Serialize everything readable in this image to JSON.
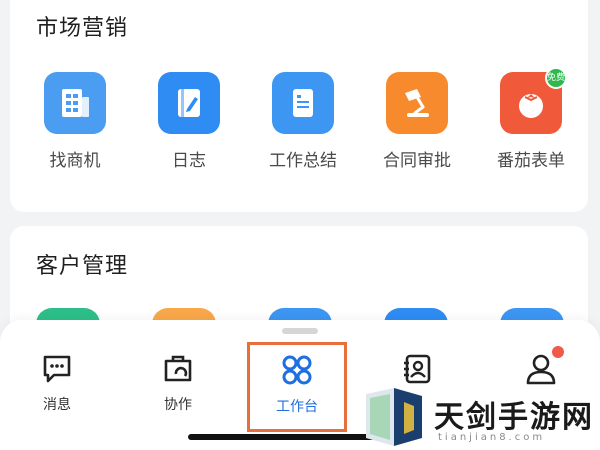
{
  "marketing": {
    "title": "市场营销",
    "apps": [
      {
        "label": "找商机",
        "color": "#4a9df0",
        "icon": "building-icon"
      },
      {
        "label": "日志",
        "color": "#2f8cf2",
        "icon": "journal-icon"
      },
      {
        "label": "工作总结",
        "color": "#3d96f2",
        "icon": "document-icon"
      },
      {
        "label": "合同审批",
        "color": "#f88a2e",
        "icon": "desk-lamp-icon"
      },
      {
        "label": "番茄表单",
        "color": "#f05a3a",
        "icon": "tomato-icon",
        "badge": "免费"
      }
    ]
  },
  "customer": {
    "title": "客户管理"
  },
  "tabs": [
    {
      "label": "消息",
      "icon": "chat-icon",
      "active": false
    },
    {
      "label": "协作",
      "icon": "briefcase-icon",
      "active": false
    },
    {
      "label": "工作台",
      "icon": "grid-icon",
      "active": true
    },
    {
      "label": "",
      "icon": "contacts-icon",
      "active": false
    },
    {
      "label": "",
      "icon": "person-icon",
      "active": false,
      "notification_dot": true
    }
  ],
  "colors": {
    "accent": "#1e6fe0",
    "highlight_frame": "#e86e3c",
    "notification": "#f05a4a"
  },
  "watermark": {
    "title": "天剑手游网",
    "domain": "tianjian8.com"
  }
}
